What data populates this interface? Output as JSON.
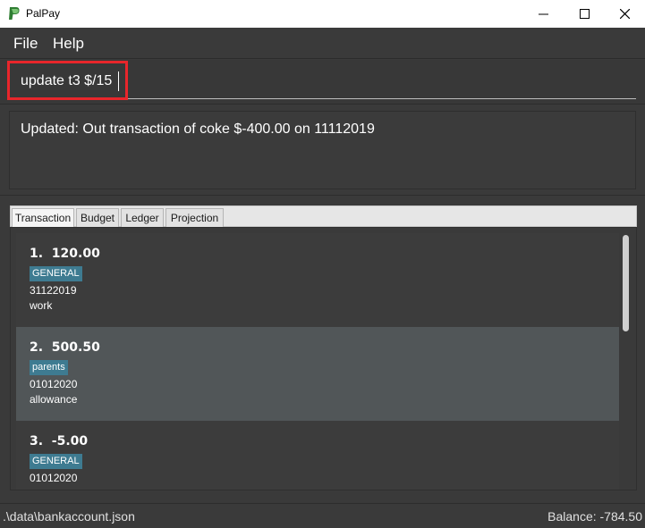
{
  "window": {
    "title": "PalPay",
    "min_icon": "minimize-icon",
    "max_icon": "maximize-icon",
    "close_icon": "close-icon"
  },
  "menu": {
    "file": "File",
    "help": "Help"
  },
  "command": {
    "value": "update t3 $/15"
  },
  "result": {
    "text": "Updated: Out transaction of coke $-400.00 on 11112019"
  },
  "tabs": [
    {
      "label": "Transaction",
      "active": true
    },
    {
      "label": "Budget",
      "active": false
    },
    {
      "label": "Ledger",
      "active": false
    },
    {
      "label": "Projection",
      "active": false
    }
  ],
  "transactions": [
    {
      "title": "1.  120.00",
      "tag": "GENERAL",
      "date": "31122019",
      "description": "work"
    },
    {
      "title": "2.  500.50",
      "tag": "parents",
      "date": "01012020",
      "description": "allowance"
    },
    {
      "title": "3.  -5.00",
      "tag": "GENERAL",
      "date": "01012020",
      "description": ""
    }
  ],
  "status": {
    "file_path": ".\\data\\bankaccount.json",
    "balance": "Balance: -784.50"
  },
  "colors": {
    "background": "#3a3a3a",
    "selected_row": "#515658",
    "tag": "#3e7b91",
    "highlight": "#e8262b"
  }
}
